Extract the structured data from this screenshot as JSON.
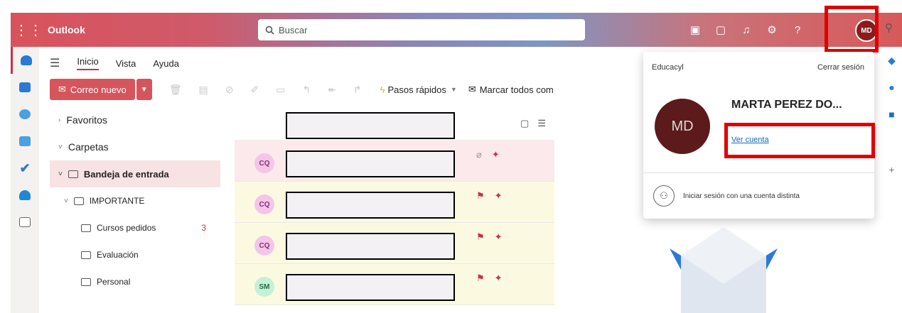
{
  "header": {
    "app_title": "Outlook",
    "search_placeholder": "Buscar",
    "avatar_initials": "MD"
  },
  "ribbon": {
    "tabs": [
      "Inicio",
      "Vista",
      "Ayuda"
    ],
    "new_mail_label": "Correo nuevo",
    "quick_steps_label": "Pasos rápidos",
    "mark_all_label": "Marcar todos com"
  },
  "folders": {
    "favorites": "Favoritos",
    "folders_section": "Carpetas",
    "inbox": "Bandeja de entrada",
    "important": "IMPORTANTE",
    "courses": "Cursos pedidos",
    "courses_count": "3",
    "evaluation": "Evaluación",
    "personal": "Personal"
  },
  "messages": [
    {
      "initials": "CQ",
      "avatar_color": "#f3c6e8"
    },
    {
      "initials": "CQ",
      "avatar_color": "#f3c6e8"
    },
    {
      "initials": "CQ",
      "avatar_color": "#f3c6e8"
    },
    {
      "initials": "SM",
      "avatar_color": "#c6f0d8"
    }
  ],
  "account_popup": {
    "organization": "Educacyl",
    "sign_out": "Cerrar sesión",
    "user_name": "MARTA PEREZ DO...",
    "avatar_initials": "MD",
    "view_account": "Ver cuenta",
    "other_account": "Iniciar sesión con una cuenta distinta"
  },
  "colors": {
    "accent": "#c4314b",
    "highlight_box": "#e00000",
    "link": "#0f6cbd"
  }
}
